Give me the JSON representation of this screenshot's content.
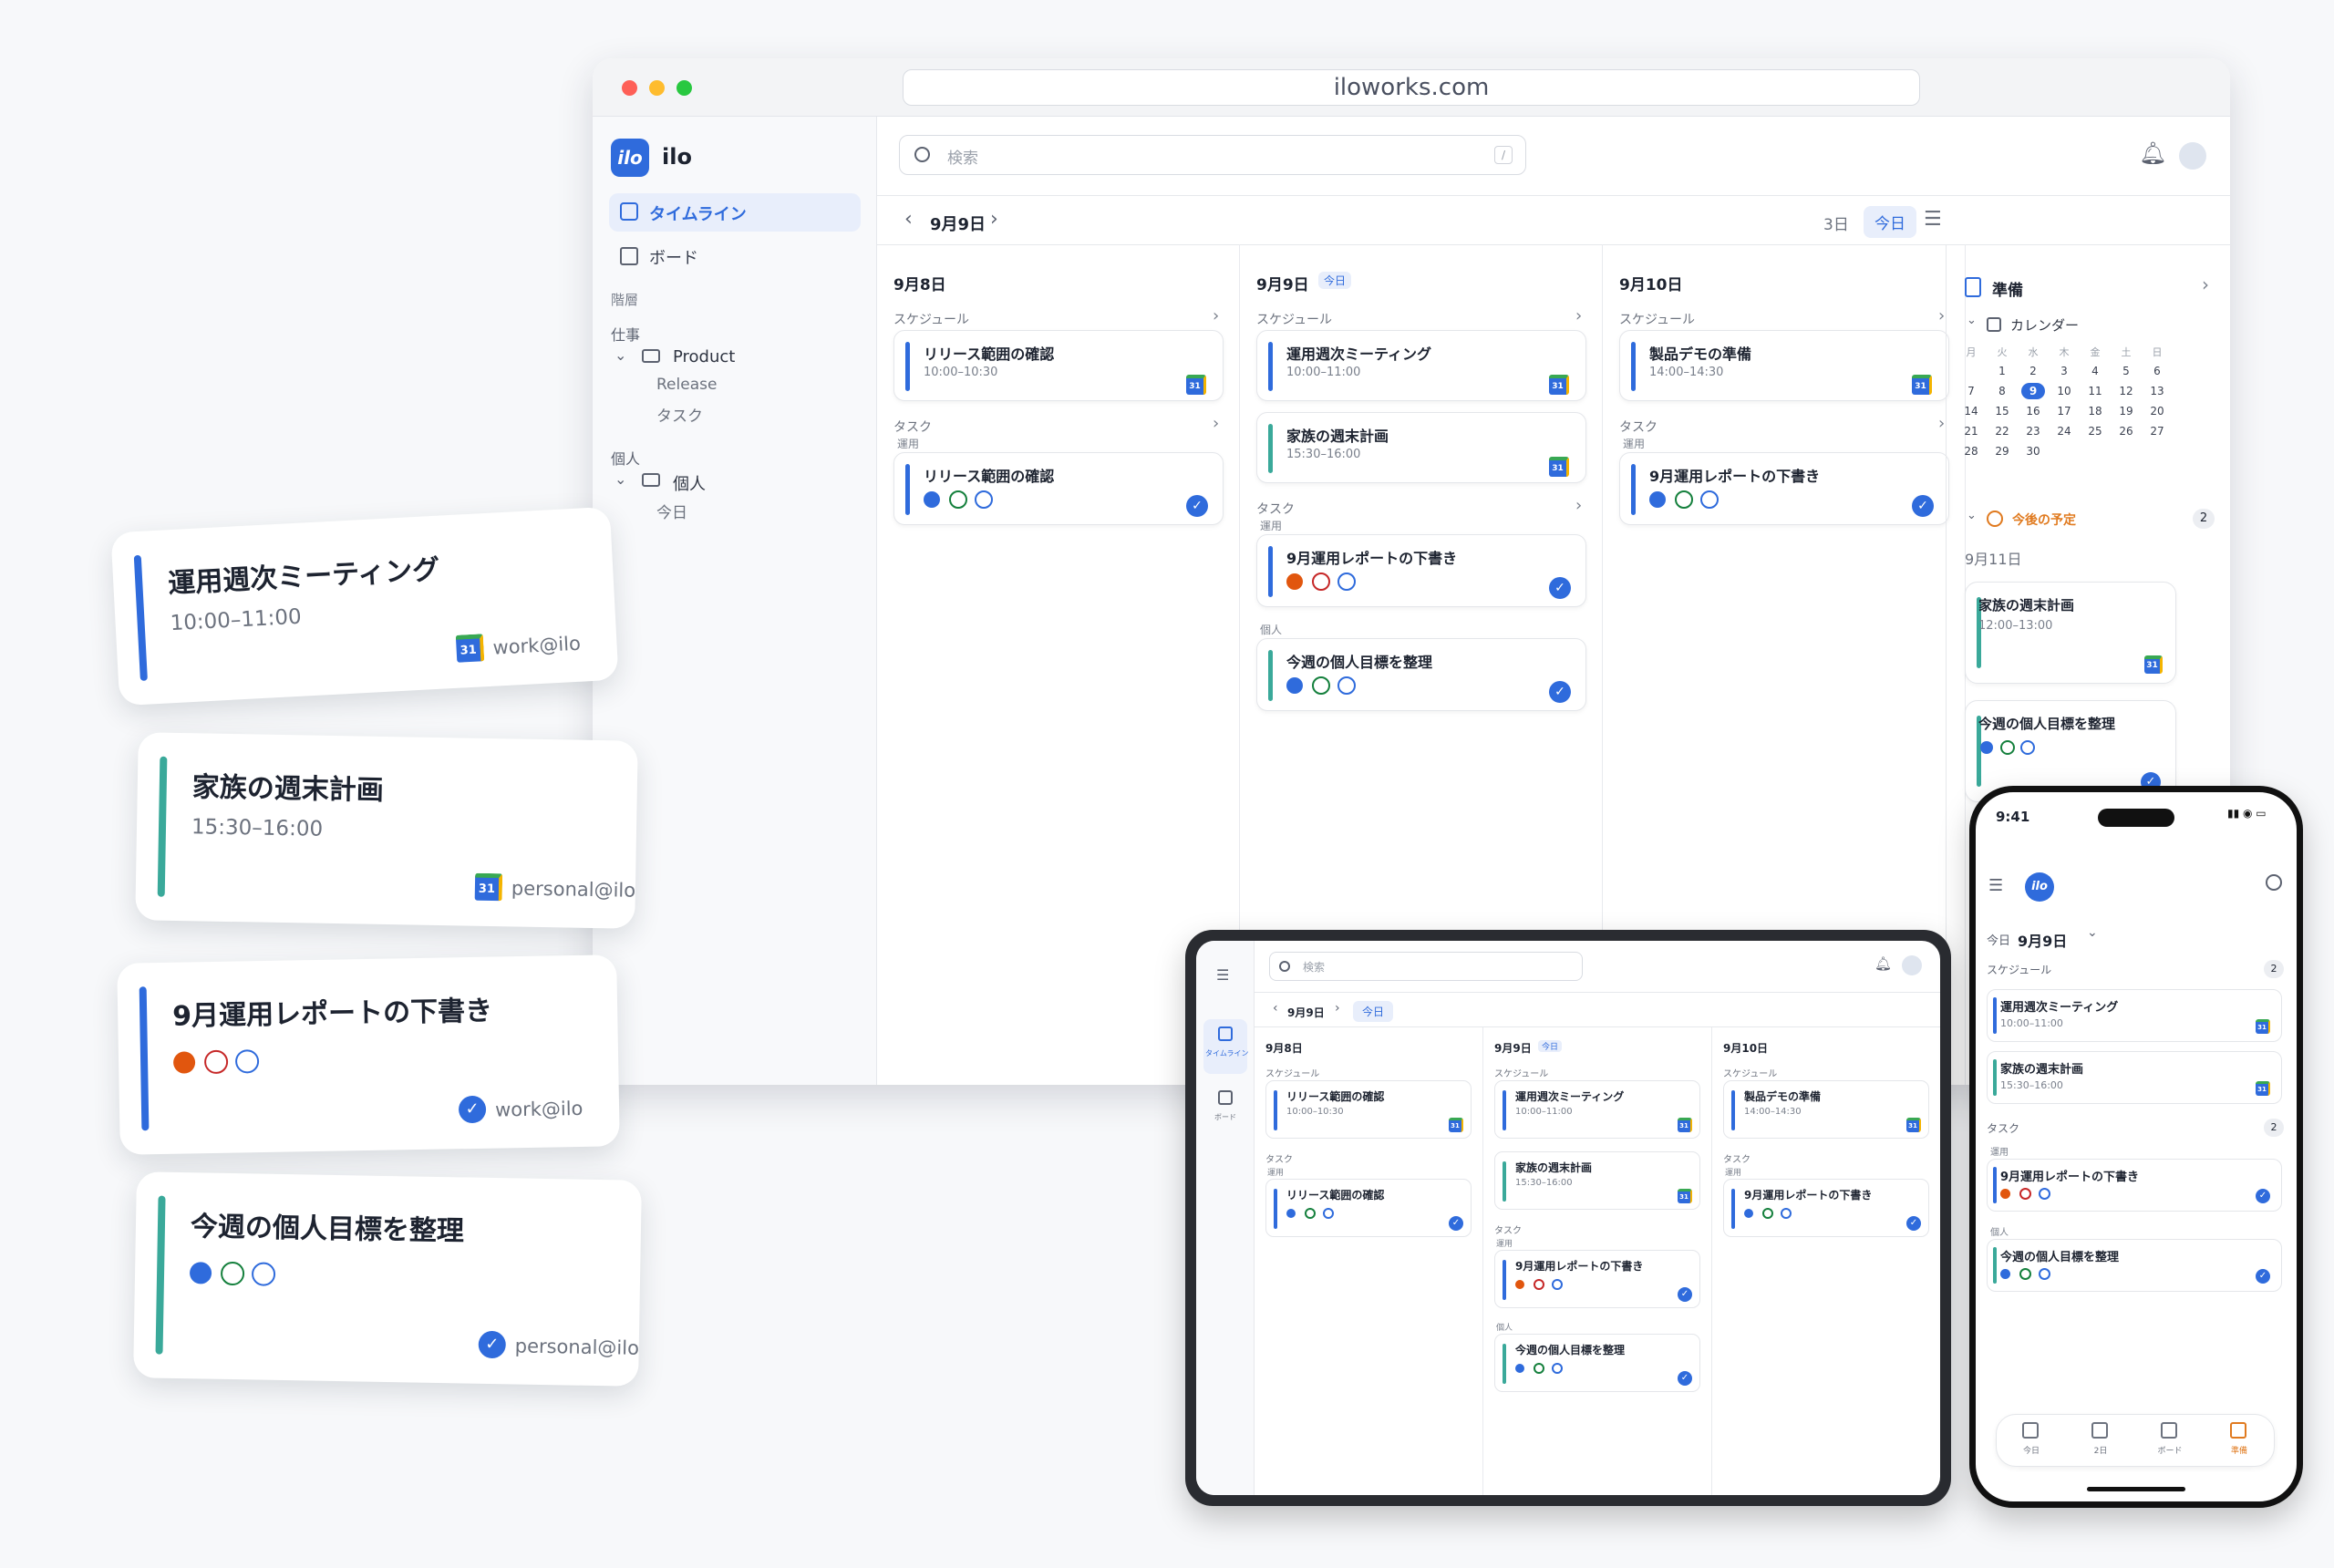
{
  "browser": {
    "url": "iloworks.com"
  },
  "app": {
    "logo": "ilo",
    "name": "ilo"
  },
  "sidebar": {
    "nav": [
      {
        "label": "タイムライン",
        "icon": "calendar-icon",
        "active": true
      },
      {
        "label": "ボード",
        "icon": "board-icon",
        "active": false
      }
    ],
    "hierarchy_label": "階層",
    "groups": [
      {
        "label": "仕事",
        "folder": "Product",
        "children": [
          "Release",
          "タスク"
        ]
      },
      {
        "label": "個人",
        "folder": "個人",
        "children": [
          "今日"
        ]
      }
    ]
  },
  "search": {
    "placeholder": "検索",
    "shortcut": "/"
  },
  "toolbar": {
    "date": "9月9日",
    "range": "3日",
    "today": "今日"
  },
  "columns": [
    {
      "date": "9月8日",
      "badge": "",
      "schedule_label": "スケジュール",
      "events": [
        {
          "title": "リリース範囲の確認",
          "time": "10:00–10:30",
          "color": "#2f6bdc"
        }
      ],
      "task_label": "タスク",
      "task_groups": [
        {
          "label": "運用",
          "tasks": [
            {
              "title": "リリース範囲の確認",
              "color": "#2f6bdc",
              "icons": [
                "#2f6bdc",
                "#15803d",
                "#2f6bdc"
              ]
            }
          ]
        }
      ]
    },
    {
      "date": "9月9日",
      "badge": "今日",
      "schedule_label": "スケジュール",
      "events": [
        {
          "title": "運用週次ミーティング",
          "time": "10:00–11:00",
          "color": "#2f6bdc"
        },
        {
          "title": "家族の週末計画",
          "time": "15:30–16:00",
          "color": "#3aa99a"
        }
      ],
      "task_label": "タスク",
      "task_groups": [
        {
          "label": "運用",
          "tasks": [
            {
              "title": "9月運用レポートの下書き",
              "color": "#2f6bdc",
              "icons": [
                "#e1560e",
                "#c62828",
                "#2f6bdc"
              ]
            }
          ]
        },
        {
          "label": "個人",
          "tasks": [
            {
              "title": "今週の個人目標を整理",
              "color": "#3aa99a",
              "icons": [
                "#2f6bdc",
                "#15803d",
                "#2f6bdc"
              ]
            }
          ]
        }
      ]
    },
    {
      "date": "9月10日",
      "badge": "",
      "schedule_label": "スケジュール",
      "events": [
        {
          "title": "製品デモの準備",
          "time": "14:00–14:30",
          "color": "#2f6bdc"
        }
      ],
      "task_label": "タスク",
      "task_groups": [
        {
          "label": "運用",
          "tasks": [
            {
              "title": "9月運用レポートの下書き",
              "color": "#2f6bdc",
              "icons": [
                "#2f6bdc",
                "#15803d",
                "#2f6bdc"
              ]
            }
          ]
        }
      ]
    }
  ],
  "rightpanel": {
    "title": "準備",
    "calendar_label": "カレンダー",
    "weekdays": [
      "月",
      "火",
      "水",
      "木",
      "金",
      "土",
      "日"
    ],
    "weeks": [
      [
        "",
        "1",
        "2",
        "3",
        "4",
        "5",
        "6"
      ],
      [
        "7",
        "8",
        "9",
        "10",
        "11",
        "12",
        "13"
      ],
      [
        "14",
        "15",
        "16",
        "17",
        "18",
        "19",
        "20"
      ],
      [
        "21",
        "22",
        "23",
        "24",
        "25",
        "26",
        "27"
      ],
      [
        "28",
        "29",
        "30",
        "",
        "",
        "",
        ""
      ]
    ],
    "selected_day": "9",
    "upcoming_label": "今後の予定",
    "upcoming_count": "2",
    "upcoming_date": "9月11日",
    "items": [
      {
        "title": "家族の週末計画",
        "time": "12:00–13:00",
        "kind": "event"
      },
      {
        "title": "今週の個人目標を整理",
        "time": "",
        "kind": "task"
      }
    ]
  },
  "floating": [
    {
      "title": "運用週次ミーティング",
      "time": "10:00–11:00",
      "account": "work@ilo",
      "kind": "event",
      "color": "#2f6bdc"
    },
    {
      "title": "家族の週末計画",
      "time": "15:30–16:00",
      "account": "personal@ilo",
      "kind": "event",
      "color": "#3aa99a"
    },
    {
      "title": "9月運用レポートの下書き",
      "time": "",
      "account": "work@ilo",
      "kind": "task",
      "color": "#2f6bdc",
      "icons": [
        "#e1560e",
        "#c62828",
        "#2f6bdc"
      ]
    },
    {
      "title": "今週の個人目標を整理",
      "time": "",
      "account": "personal@ilo",
      "kind": "task",
      "color": "#3aa99a",
      "icons": [
        "#2f6bdc",
        "#15803d",
        "#2f6bdc"
      ]
    }
  ],
  "tablet": {
    "search": "検索",
    "date": "9月9日",
    "today": "今日",
    "nav": [
      "タイムライン",
      "ボード"
    ]
  },
  "phone": {
    "time": "9:41",
    "today": "今日",
    "date": "9月9日",
    "schedule_label": "スケジュール",
    "schedule_count": "2",
    "events": [
      {
        "title": "運用週次ミーティング",
        "time": "10:00–11:00",
        "color": "#2f6bdc"
      },
      {
        "title": "家族の週末計画",
        "time": "15:30–16:00",
        "color": "#3aa99a"
      }
    ],
    "task_label": "タスク",
    "task_count": "2",
    "task_groups": [
      {
        "label": "運用",
        "tasks": [
          {
            "title": "9月運用レポートの下書き",
            "color": "#2f6bdc",
            "icons": [
              "#e1560e",
              "#c62828",
              "#2f6bdc"
            ]
          }
        ]
      },
      {
        "label": "個人",
        "tasks": [
          {
            "title": "今週の個人目標を整理",
            "color": "#3aa99a",
            "icons": [
              "#2f6bdc",
              "#15803d",
              "#2f6bdc"
            ]
          }
        ]
      }
    ],
    "tabs": [
      {
        "label": "今日",
        "icon": "today-icon"
      },
      {
        "label": "2日",
        "icon": "calendar-icon"
      },
      {
        "label": "ボード",
        "icon": "board-icon"
      },
      {
        "label": "準備",
        "icon": "bolt-icon",
        "active": true
      }
    ]
  },
  "colors": {
    "accent": "#2f6bdc",
    "personal": "#3aa99a",
    "warn": "#e1560e",
    "upcoming": "#e07a1f"
  }
}
